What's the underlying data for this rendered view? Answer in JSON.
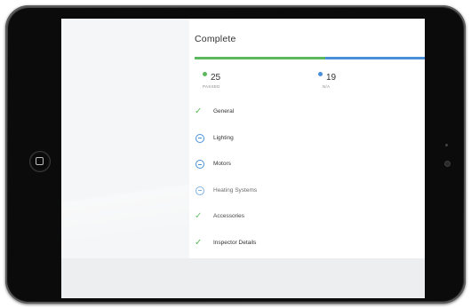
{
  "inspection": {
    "title": "Complete",
    "progress": {
      "passed_fraction": 0.568
    },
    "stats": [
      {
        "count": "25",
        "label": "PASSED",
        "color": "#5cb85c"
      },
      {
        "count": "19",
        "label": "N/A",
        "color": "#4a90d9"
      }
    ],
    "sections": [
      {
        "label": "General",
        "status_icon": "check-icon"
      },
      {
        "label": "Lighting",
        "status_icon": "minus-circle-icon"
      },
      {
        "label": "Motors",
        "status_icon": "minus-circle-icon"
      },
      {
        "label": "Heating Systems",
        "status_icon": "minus-circle-icon"
      },
      {
        "label": "Accessories",
        "status_icon": "check-icon"
      },
      {
        "label": "Inspector Details",
        "status_icon": "check-icon"
      }
    ]
  },
  "colors": {
    "passed": "#5cb85c",
    "na": "#4a90d9",
    "device_frame": "#1a1a1a",
    "screen_bg": "#eceef0"
  }
}
